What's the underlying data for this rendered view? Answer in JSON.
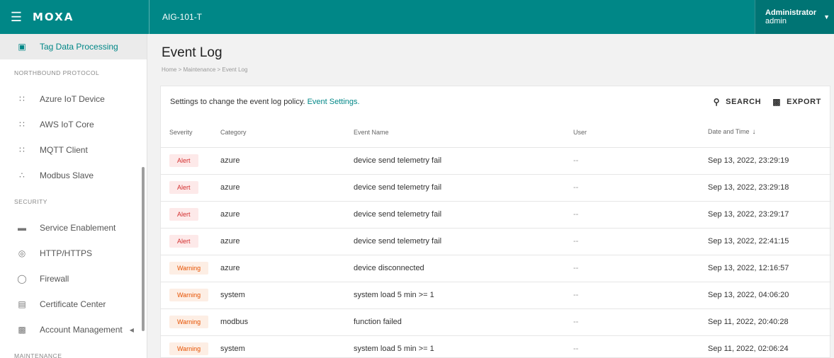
{
  "header": {
    "menu_icon": "hamburger-icon",
    "logo": "MOXA",
    "device_name": "AIG-101-T",
    "user_role": "Administrator",
    "user_name": "admin"
  },
  "sidebar": {
    "items": [
      {
        "type": "item",
        "icon": "tag-icon",
        "label": "Tag Data Processing",
        "active": true
      },
      {
        "type": "section",
        "label": "NORTHBOUND PROTOCOL"
      },
      {
        "type": "item",
        "icon": "grid-icon",
        "label": "Azure IoT Device"
      },
      {
        "type": "item",
        "icon": "grid-icon",
        "label": "AWS IoT Core"
      },
      {
        "type": "item",
        "icon": "grid-icon",
        "label": "MQTT Client"
      },
      {
        "type": "item",
        "icon": "sliders-icon",
        "label": "Modbus Slave"
      },
      {
        "type": "section",
        "label": "SECURITY"
      },
      {
        "type": "item",
        "icon": "toggle-icon",
        "label": "Service Enablement"
      },
      {
        "type": "item",
        "icon": "globe-icon",
        "label": "HTTP/HTTPS"
      },
      {
        "type": "item",
        "icon": "shield-icon",
        "label": "Firewall"
      },
      {
        "type": "item",
        "icon": "certificate-icon",
        "label": "Certificate Center"
      },
      {
        "type": "item",
        "icon": "account-icon",
        "label": "Account Management",
        "expandable": true
      },
      {
        "type": "section",
        "label": "MAINTENANCE"
      }
    ]
  },
  "page": {
    "title": "Event Log",
    "breadcrumb": "Home > Maintenance > Event Log"
  },
  "card": {
    "info_text": "Settings to change the event log policy.",
    "info_link": "Event Settings.",
    "search_label": "SEARCH",
    "export_label": "EXPORT"
  },
  "table": {
    "columns": [
      "Severity",
      "Category",
      "Event Name",
      "User",
      "Date and Time"
    ],
    "rows": [
      {
        "severity": "Alert",
        "category": "azure",
        "event": "device send telemetry fail",
        "user": "--",
        "datetime": "Sep 13, 2022, 23:29:19"
      },
      {
        "severity": "Alert",
        "category": "azure",
        "event": "device send telemetry fail",
        "user": "--",
        "datetime": "Sep 13, 2022, 23:29:18"
      },
      {
        "severity": "Alert",
        "category": "azure",
        "event": "device send telemetry fail",
        "user": "--",
        "datetime": "Sep 13, 2022, 23:29:17"
      },
      {
        "severity": "Alert",
        "category": "azure",
        "event": "device send telemetry fail",
        "user": "--",
        "datetime": "Sep 13, 2022, 22:41:15"
      },
      {
        "severity": "Warning",
        "category": "azure",
        "event": "device disconnected",
        "user": "--",
        "datetime": "Sep 13, 2022, 12:16:57"
      },
      {
        "severity": "Warning",
        "category": "system",
        "event": "system load 5 min >= 1",
        "user": "--",
        "datetime": "Sep 13, 2022, 04:06:20"
      },
      {
        "severity": "Warning",
        "category": "modbus",
        "event": "function failed",
        "user": "--",
        "datetime": "Sep 11, 2022, 20:40:28"
      },
      {
        "severity": "Warning",
        "category": "system",
        "event": "system load 5 min >= 1",
        "user": "--",
        "datetime": "Sep 11, 2022, 02:06:24"
      }
    ]
  },
  "colors": {
    "brand": "#008787",
    "alert": "#d32f2f",
    "warning": "#e65100"
  }
}
